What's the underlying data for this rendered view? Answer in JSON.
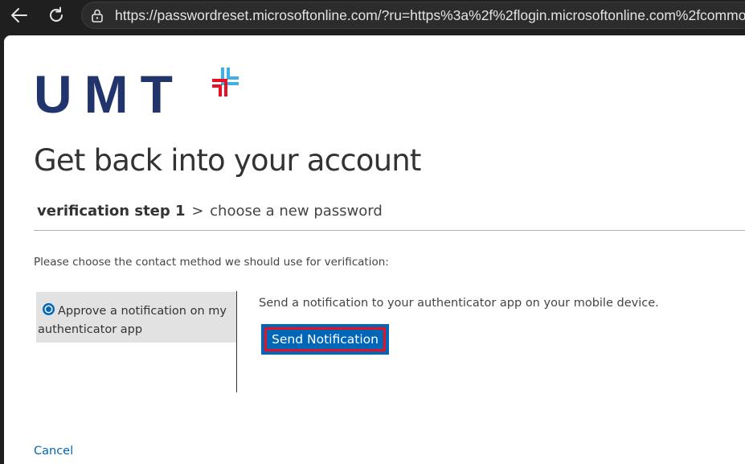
{
  "browser": {
    "url": "https://passwordreset.microsoftonline.com/?ru=https%3a%2f%2flogin.microsoftonline.com%2fcommo"
  },
  "logo": {
    "text": "UMT",
    "colors": {
      "text": "#21346b",
      "red": "#e81123",
      "blue": "#3fb0e6"
    }
  },
  "page": {
    "heading": "Get back into your account",
    "steps": {
      "active": "verification step 1",
      "separator": ">",
      "next": "choose a new password"
    },
    "instruction": "Please choose the contact method we should use for verification:",
    "methods": [
      {
        "label": "Approve a notification on my authenticator app",
        "selected": true
      }
    ],
    "method_description": "Send a notification to your authenticator app on your mobile device.",
    "send_button": "Send Notification",
    "cancel_link": "Cancel"
  },
  "colors": {
    "accent": "#0067b8",
    "highlight": "#e81123"
  }
}
